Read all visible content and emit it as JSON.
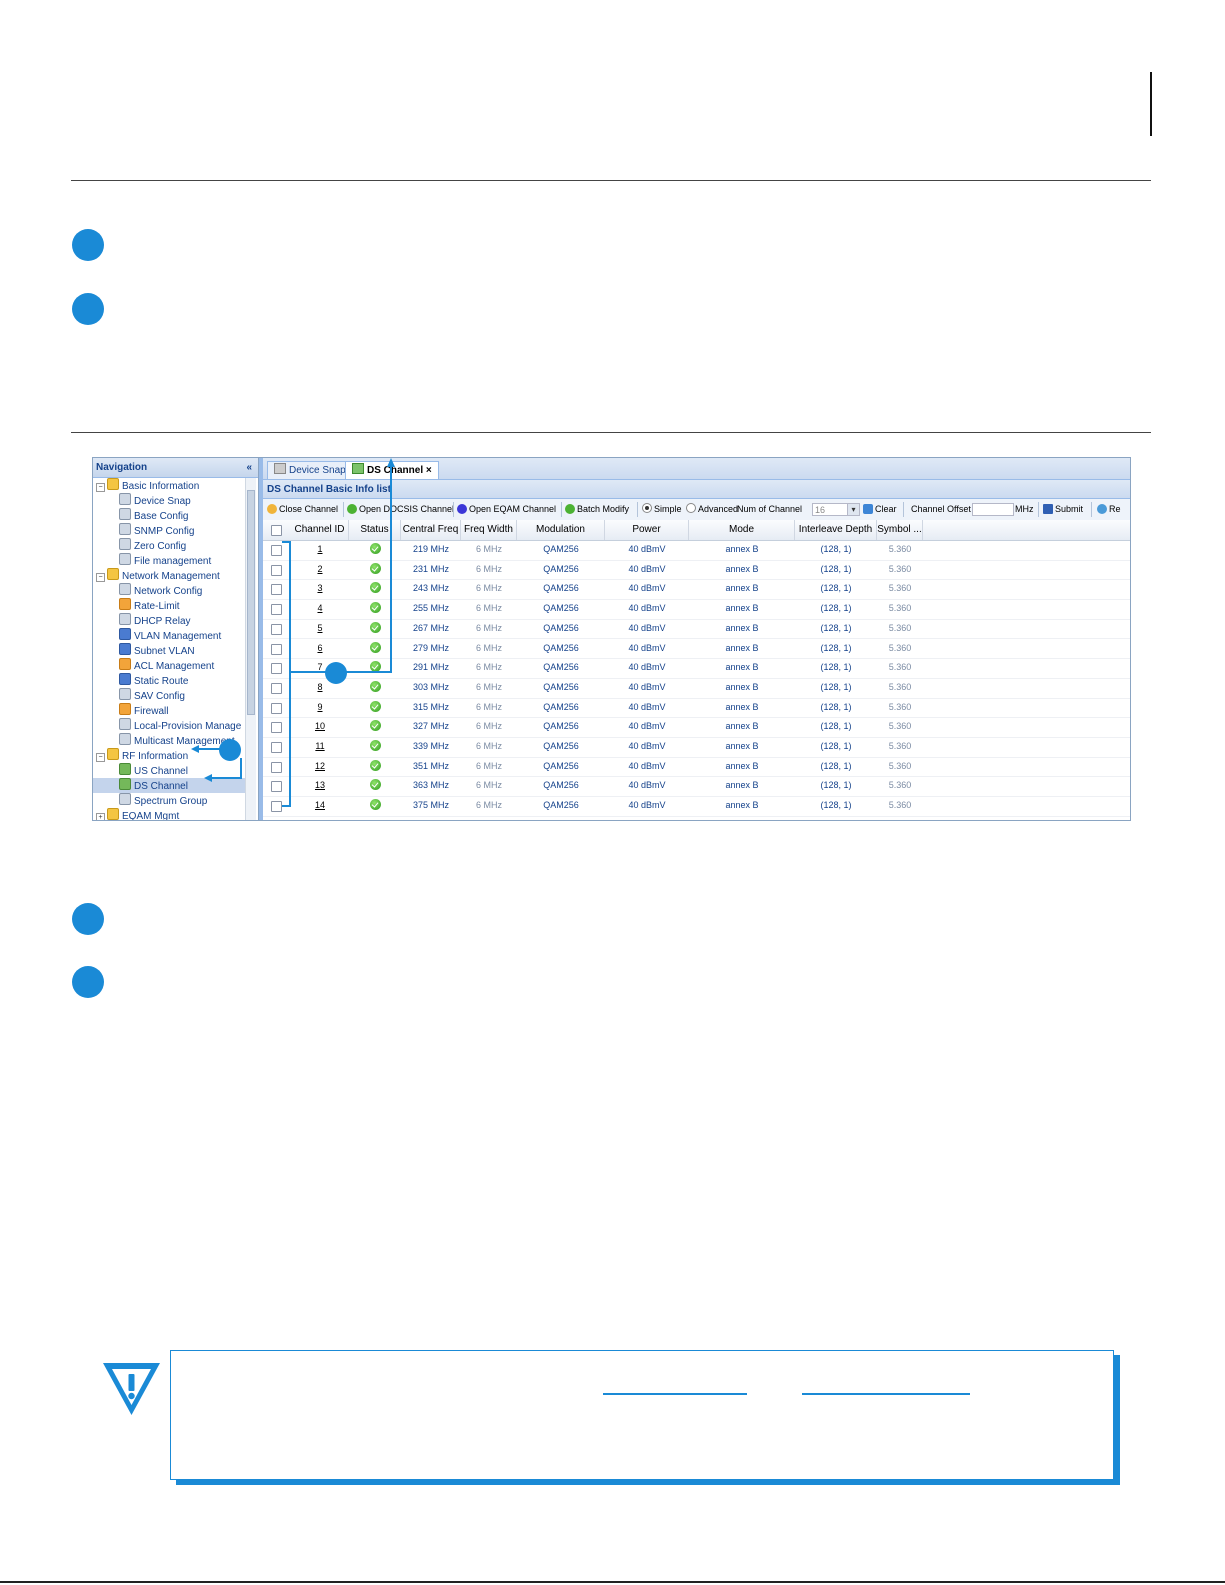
{
  "screenshot": {
    "nav": {
      "title": "Navigation",
      "collapse": "«",
      "items": [
        {
          "label": "Basic Information",
          "level": 0,
          "icon": "folder-icon",
          "pm": "−"
        },
        {
          "label": "Device Snap",
          "level": 1,
          "icon": "device-icon"
        },
        {
          "label": "Base Config",
          "level": 1,
          "icon": "config-icon"
        },
        {
          "label": "SNMP Config",
          "level": 1,
          "icon": "snmp-icon"
        },
        {
          "label": "Zero Config",
          "level": 1,
          "icon": "gear-icon"
        },
        {
          "label": "File management",
          "level": 1,
          "icon": "file-icon"
        },
        {
          "label": "Network Management",
          "level": 0,
          "icon": "folder-icon",
          "pm": "−"
        },
        {
          "label": "Network Config",
          "level": 1,
          "icon": "network-icon"
        },
        {
          "label": "Rate-Limit",
          "level": 1,
          "icon": "rate-icon"
        },
        {
          "label": "DHCP Relay",
          "level": 1,
          "icon": "dhcp-icon"
        },
        {
          "label": "VLAN Management",
          "level": 1,
          "icon": "vlan-icon"
        },
        {
          "label": "Subnet VLAN",
          "level": 1,
          "icon": "subnet-icon"
        },
        {
          "label": "ACL Management",
          "level": 1,
          "icon": "acl-icon"
        },
        {
          "label": "Static Route",
          "level": 1,
          "icon": "route-icon"
        },
        {
          "label": "SAV Config",
          "level": 1,
          "icon": "gear-icon"
        },
        {
          "label": "Firewall",
          "level": 1,
          "icon": "firewall-icon"
        },
        {
          "label": "Local-Provision Manage",
          "level": 1,
          "icon": "gear-icon"
        },
        {
          "label": "Multicast Management",
          "level": 1,
          "icon": "gear-icon"
        },
        {
          "label": "RF Information",
          "level": 0,
          "icon": "folder-icon",
          "pm": "−"
        },
        {
          "label": "US Channel",
          "level": 1,
          "icon": "channel-icon"
        },
        {
          "label": "DS Channel",
          "level": 1,
          "icon": "channel-icon",
          "selected": true
        },
        {
          "label": "Spectrum Group",
          "level": 1,
          "icon": "gear-icon"
        },
        {
          "label": "EQAM Mgmt",
          "level": 0,
          "icon": "folder-icon",
          "pm": "+"
        }
      ]
    },
    "tabs": [
      {
        "label": "Device Snap",
        "active": false
      },
      {
        "label": "DS Channel",
        "active": true,
        "close": "×"
      }
    ],
    "panel_title": "DS Channel Basic Info list",
    "toolbar": {
      "close_channel": "Close Channel",
      "open_docsis": "Open DOCSIS Channel",
      "open_eqam": "Open EQAM Channel",
      "batch_modify": "Batch Modify",
      "simple": "Simple",
      "advanced": "Advanced",
      "num_of_channel": "Num of Channel",
      "num_value": "16",
      "clear": "Clear",
      "channel_offset": "Channel Offset",
      "mhz": "MHz",
      "submit": "Submit",
      "refresh": "Re"
    },
    "columns": [
      "Channel ID",
      "Status",
      "Central Freq",
      "Freq Width",
      "Modulation",
      "Power",
      "Mode",
      "Interleave Depth",
      "Symbol ..."
    ],
    "rows": [
      {
        "id": "1",
        "freq": "219 MHz",
        "width": "6 MHz",
        "mod": "QAM256",
        "power": "40 dBmV",
        "mode": "annex B",
        "depth": "(128, 1)",
        "symbol": "5.360"
      },
      {
        "id": "2",
        "freq": "231 MHz",
        "width": "6 MHz",
        "mod": "QAM256",
        "power": "40 dBmV",
        "mode": "annex B",
        "depth": "(128, 1)",
        "symbol": "5.360"
      },
      {
        "id": "3",
        "freq": "243 MHz",
        "width": "6 MHz",
        "mod": "QAM256",
        "power": "40 dBmV",
        "mode": "annex B",
        "depth": "(128, 1)",
        "symbol": "5.360"
      },
      {
        "id": "4",
        "freq": "255 MHz",
        "width": "6 MHz",
        "mod": "QAM256",
        "power": "40 dBmV",
        "mode": "annex B",
        "depth": "(128, 1)",
        "symbol": "5.360"
      },
      {
        "id": "5",
        "freq": "267 MHz",
        "width": "6 MHz",
        "mod": "QAM256",
        "power": "40 dBmV",
        "mode": "annex B",
        "depth": "(128, 1)",
        "symbol": "5.360"
      },
      {
        "id": "6",
        "freq": "279 MHz",
        "width": "6 MHz",
        "mod": "QAM256",
        "power": "40 dBmV",
        "mode": "annex B",
        "depth": "(128, 1)",
        "symbol": "5.360"
      },
      {
        "id": "7",
        "freq": "291 MHz",
        "width": "6 MHz",
        "mod": "QAM256",
        "power": "40 dBmV",
        "mode": "annex B",
        "depth": "(128, 1)",
        "symbol": "5.360"
      },
      {
        "id": "8",
        "freq": "303 MHz",
        "width": "6 MHz",
        "mod": "QAM256",
        "power": "40 dBmV",
        "mode": "annex B",
        "depth": "(128, 1)",
        "symbol": "5.360"
      },
      {
        "id": "9",
        "freq": "315 MHz",
        "width": "6 MHz",
        "mod": "QAM256",
        "power": "40 dBmV",
        "mode": "annex B",
        "depth": "(128, 1)",
        "symbol": "5.360"
      },
      {
        "id": "10",
        "freq": "327 MHz",
        "width": "6 MHz",
        "mod": "QAM256",
        "power": "40 dBmV",
        "mode": "annex B",
        "depth": "(128, 1)",
        "symbol": "5.360"
      },
      {
        "id": "11",
        "freq": "339 MHz",
        "width": "6 MHz",
        "mod": "QAM256",
        "power": "40 dBmV",
        "mode": "annex B",
        "depth": "(128, 1)",
        "symbol": "5.360"
      },
      {
        "id": "12",
        "freq": "351 MHz",
        "width": "6 MHz",
        "mod": "QAM256",
        "power": "40 dBmV",
        "mode": "annex B",
        "depth": "(128, 1)",
        "symbol": "5.360"
      },
      {
        "id": "13",
        "freq": "363 MHz",
        "width": "6 MHz",
        "mod": "QAM256",
        "power": "40 dBmV",
        "mode": "annex B",
        "depth": "(128, 1)",
        "symbol": "5.360"
      },
      {
        "id": "14",
        "freq": "375 MHz",
        "width": "6 MHz",
        "mod": "QAM256",
        "power": "40 dBmV",
        "mode": "annex B",
        "depth": "(128, 1)",
        "symbol": "5.360"
      }
    ]
  },
  "colors": {
    "accent": "#1a8ad6",
    "ext_header": "#15428b"
  }
}
